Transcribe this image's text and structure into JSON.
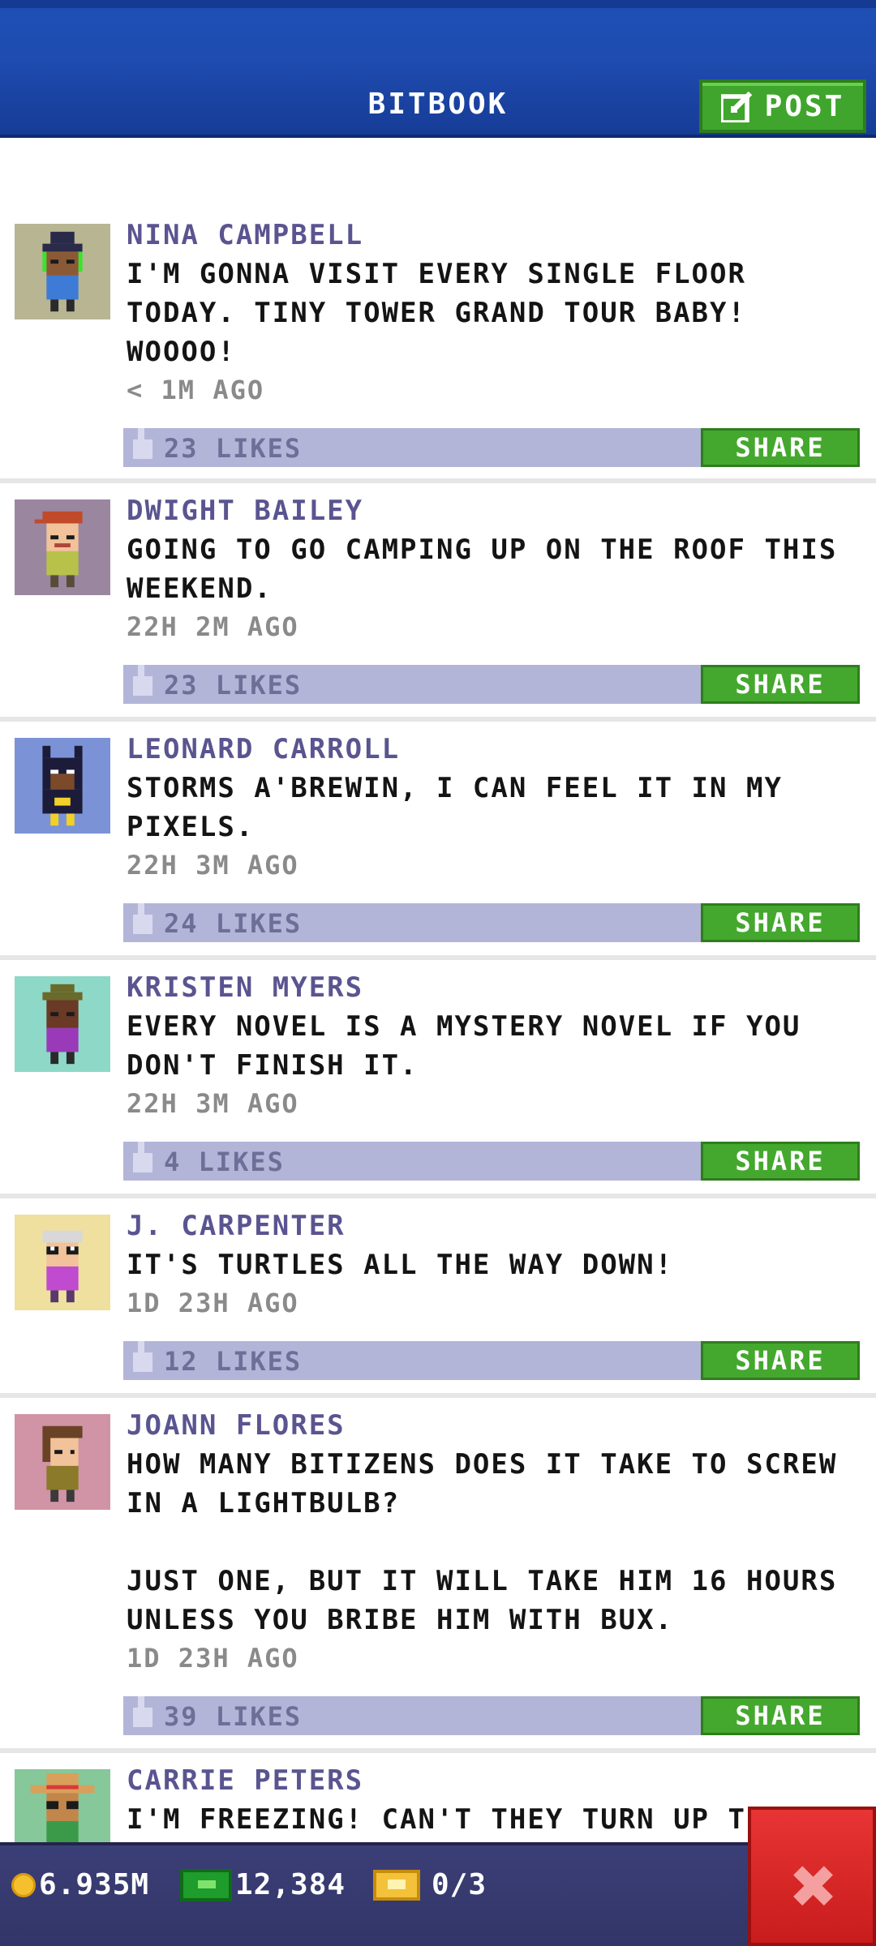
{
  "header": {
    "title": "BITBOOK",
    "post_label": "POST"
  },
  "posts": [
    {
      "name": "NINA CAMPBELL",
      "message": "I'M GONNA VISIT EVERY SINGLE FLOOR TODAY. TINY TOWER GRAND TOUR BABY! WOOOO!",
      "time": "< 1M AGO",
      "likes": "23 LIKES",
      "share": "SHARE"
    },
    {
      "name": "DWIGHT BAILEY",
      "message": "GOING TO GO CAMPING UP ON THE ROOF THIS WEEKEND.",
      "time": "22H 2M AGO",
      "likes": "23 LIKES",
      "share": "SHARE"
    },
    {
      "name": "LEONARD CARROLL",
      "message": "STORMS A'BREWIN, I CAN FEEL IT IN MY PIXELS.",
      "time": "22H 3M AGO",
      "likes": "24 LIKES",
      "share": "SHARE"
    },
    {
      "name": "KRISTEN MYERS",
      "message": "EVERY NOVEL IS A MYSTERY NOVEL IF YOU DON'T FINISH IT.",
      "time": "22H 3M AGO",
      "likes": "4 LIKES",
      "share": "SHARE"
    },
    {
      "name": "J. CARPENTER",
      "message": "IT'S TURTLES ALL THE WAY DOWN!",
      "time": "1D 23H AGO",
      "likes": "12 LIKES",
      "share": "SHARE"
    },
    {
      "name": "JOANN FLORES",
      "message": "HOW MANY BITIZENS DOES IT TAKE TO SCREW IN A LIGHTBULB?\n\nJUST ONE, BUT IT WILL TAKE HIM 16 HOURS UNLESS YOU BRIBE HIM WITH BUX.",
      "time": "1D 23H AGO",
      "likes": "39 LIKES",
      "share": "SHARE"
    },
    {
      "name": "CARRIE PETERS",
      "message": "I'M FREEZING! CAN'T THEY TURN UP THE",
      "time": "",
      "likes": "",
      "share": ""
    }
  ],
  "status": {
    "coins": "6.935M",
    "bux": "12,384",
    "tickets": "0/3"
  },
  "icons": {
    "post": "edit-icon",
    "like": "thumbs-up-icon",
    "coin": "coin-icon",
    "bux": "bux-icon",
    "ticket": "ticket-icon",
    "close": "close-icon"
  },
  "colors": {
    "header_blue": "#1e4cb0",
    "accent_green": "#44a82e",
    "name_purple": "#5a5490",
    "likes_bar": "#b3b5d8",
    "close_red": "#d82626"
  }
}
